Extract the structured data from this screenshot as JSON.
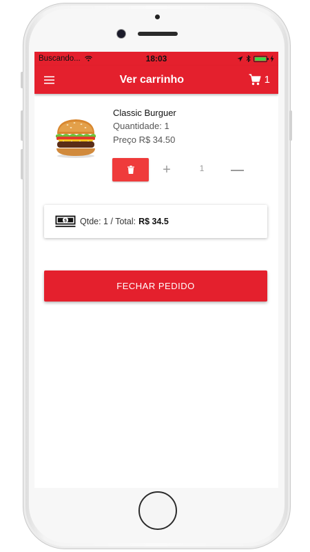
{
  "status_bar": {
    "carrier": "Buscando...",
    "time": "18:03"
  },
  "app_bar": {
    "title": "Ver carrinho",
    "cart_count": "1"
  },
  "cart_item": {
    "name": "Classic Burguer",
    "quantity_label": "Quantidade: 1",
    "price_label": "Preço R$ 34.50",
    "stepper_value": "1",
    "image_icon": "burger-image"
  },
  "summary": {
    "text": "Qtde: 1 / Total:",
    "total": "R$ 34.5",
    "icon": "money-icon"
  },
  "checkout_button": {
    "label": "FECHAR PEDIDO"
  },
  "colors": {
    "primary": "#e4202d",
    "delete": "#ef3b3b"
  }
}
